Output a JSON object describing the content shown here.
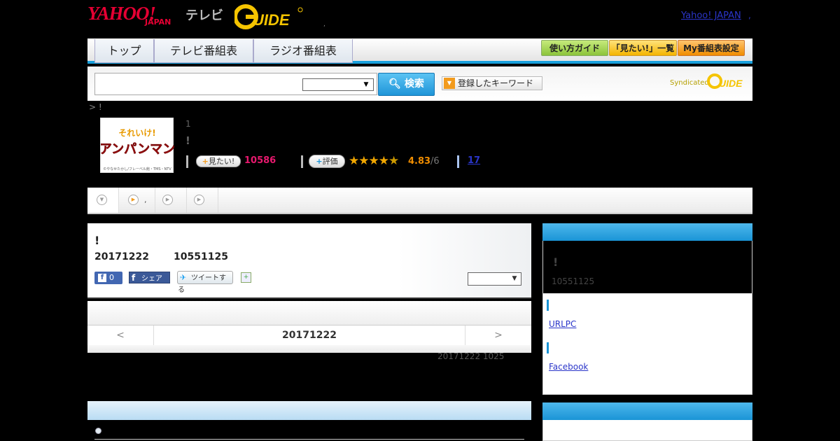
{
  "header": {
    "yahoo_logo": "YAHOO!",
    "yahoo_sub": "JAPAN",
    "tv_label": "テレビ",
    "gguide_logo": "G GUIDE",
    "dot": ",",
    "yahoo_japan_link": "Yahoo! JAPAN",
    "link_dot": ","
  },
  "nav": {
    "tabs": [
      "トップ",
      "テレビ番組表",
      "ラジオ番組表"
    ],
    "right_buttons": [
      "使い方ガイド",
      "「見たい!」一覧",
      "My番組表設定"
    ]
  },
  "search": {
    "input_value": "",
    "select_value": "",
    "button_label": "検索",
    "keyword_button": "登録したキーワード",
    "syndicated": "Syndicated"
  },
  "breadcrumb": "> !",
  "program": {
    "thumbnail_alt": "それいけ!アンパンマン",
    "thumbnail_caption": "©やなせたかし/フレーベル館・TMS・NTV",
    "episode": "1",
    "title": "!",
    "mitai_label": "見たい!",
    "mitai_count": "10586",
    "hyoka_label": "評価",
    "rating": 4.83,
    "rating_text": "4.83",
    "rating_max": "/6",
    "review_count": "17"
  },
  "subtabs": [
    ",",
    ""
  ],
  "main": {
    "title": "!",
    "date": "20171222",
    "time": "10551125",
    "fb_like_count": "0",
    "fb_share": "シェア",
    "tweet": "ツイートする",
    "select_value": ""
  },
  "datenav": {
    "prev": "<",
    "date": "20171222",
    "next": ">",
    "updated": "20171222  1025"
  },
  "side": {
    "title": "!",
    "time": "10551125",
    "url_link": "URLPC",
    "facebook_link": "Facebook"
  },
  "colors": {
    "accent_blue": "#1a94d6",
    "yahoo_red": "#e60033",
    "mitai_pink": "#e8196e",
    "rating_orange": "#f08d00"
  }
}
